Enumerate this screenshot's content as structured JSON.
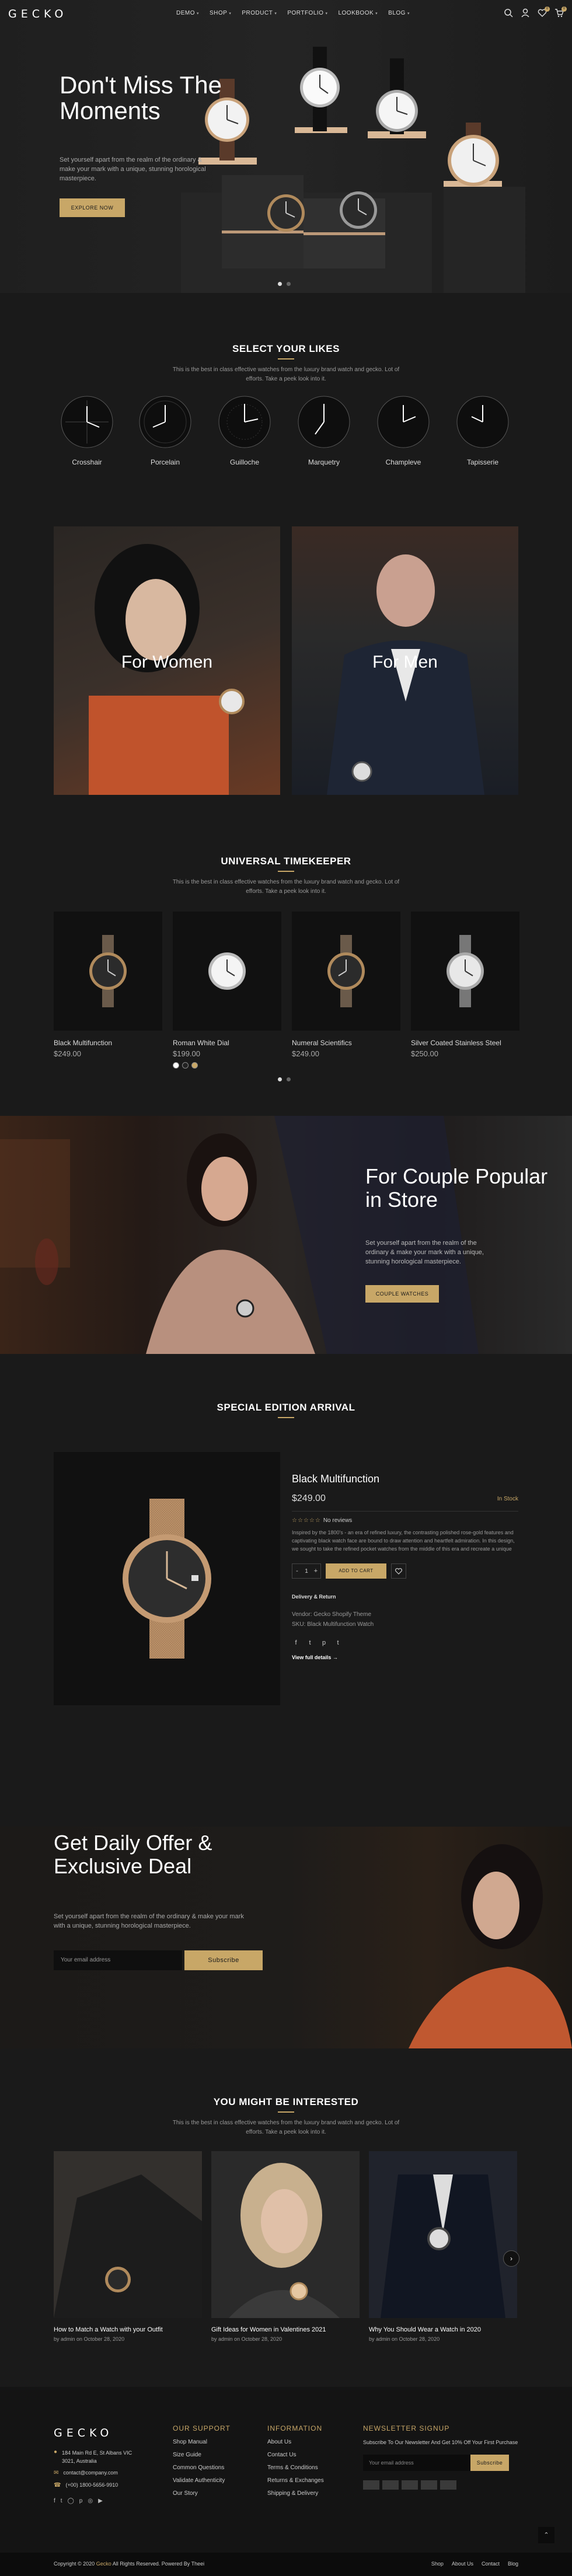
{
  "header": {
    "logo": "GECKO",
    "nav": [
      {
        "label": "DEMO"
      },
      {
        "label": "SHOP"
      },
      {
        "label": "PRODUCT"
      },
      {
        "label": "PORTFOLIO"
      },
      {
        "label": "LOOKBOOK"
      },
      {
        "label": "BLOG"
      }
    ],
    "wishlist_count": "0",
    "cart_count": "0"
  },
  "hero": {
    "title": "Don't Miss The Moments",
    "text": "Set yourself apart from the realm of the ordinary & make your mark with a unique, stunning horological masterpiece.",
    "button": "EXPLORE NOW"
  },
  "likes": {
    "title": "SELECT YOUR LIKES",
    "subtitle": "This is the best in class effective watches from the luxury brand watch and gecko. Lot of efforts. Take a peek look into it.",
    "categories": [
      {
        "label": "Crosshair"
      },
      {
        "label": "Porcelain"
      },
      {
        "label": "Guilloche"
      },
      {
        "label": "Marquetry"
      },
      {
        "label": "Champleve"
      },
      {
        "label": "Tapisserie"
      }
    ]
  },
  "banners": {
    "women": "For Women",
    "men": "For Men"
  },
  "timekeeper": {
    "title": "UNIVERSAL TIMEKEEPER",
    "subtitle": "This is the best in class effective watches from the luxury brand watch and gecko. Lot of efforts. Take a peek look into it.",
    "products": [
      {
        "name": "Black Multifunction",
        "price": "$249.00"
      },
      {
        "name": "Roman White Dial",
        "price": "$199.00"
      },
      {
        "name": "Numeral Scientifics",
        "price": "$249.00"
      },
      {
        "name": "Silver Coated Stainless Steel",
        "price": "$250.00"
      }
    ],
    "swatch_colors": [
      "#ffffff",
      "#222222",
      "#c8a767"
    ]
  },
  "couple": {
    "title": "For Couple Popular in Store",
    "text": "Set yourself apart from the realm of the ordinary & make your mark with a unique, stunning horological masterpiece.",
    "button": "COUPLE WATCHES"
  },
  "special": {
    "title": "SPECIAL EDITION ARRIVAL",
    "product": {
      "name": "Black Multifunction",
      "price": "$249.00",
      "stock": "In Stock",
      "reviews": "No reviews",
      "description": "Inspired by the 1800's - an era of refined luxury, the contrasting polished rose-gold features and captivating black watch face are bound to draw attention and heartfelt admiration. In this design, we sought to take the refined pocket watches from the middle of this era and recreate a unique",
      "qty": "1",
      "add_to_cart": "ADD TO CART",
      "delivery": "Delivery & Return",
      "vendor": "Vendor: Gecko Shopify Theme",
      "sku": "SKU: Black Multifunction Watch",
      "view_full": "View full details →"
    }
  },
  "offer": {
    "title": "Get Daily Offer & Exclusive Deal",
    "text": "Set yourself apart from the realm of the ordinary & make your mark with a unique, stunning horological masterpiece.",
    "email_placeholder": "Your email address",
    "button": "Subscribe"
  },
  "interested": {
    "title": "YOU MIGHT BE INTERESTED",
    "subtitle": "This is the best in class effective watches from the luxury brand watch and gecko. Lot of efforts. Take a peek look into it.",
    "posts": [
      {
        "title": "How to Match a Watch with your Outfit",
        "meta": "by admin on October 28, 2020"
      },
      {
        "title": "Gift Ideas for Women in Valentines 2021",
        "meta": "by admin on October 28, 2020"
      },
      {
        "title": "Why You Should Wear a Watch in 2020",
        "meta": "by admin on October 28, 2020"
      }
    ]
  },
  "footer": {
    "logo": "GECKO",
    "address": "184 Main Rd E, St Albans VIC 3021, Australia",
    "email": "contact@company.com",
    "phone": "(+00) 1800-5656-9910",
    "support": {
      "title": "OUR SUPPORT",
      "links": [
        "Shop Manual",
        "Size Guide",
        "Common Questions",
        "Validate Authenticity",
        "Our Story"
      ]
    },
    "information": {
      "title": "INFORMATION",
      "links": [
        "About Us",
        "Contact Us",
        "Terms & Conditions",
        "Returns & Exchanges",
        "Shipping & Delivery"
      ]
    },
    "newsletter": {
      "title": "NEWSLETTER SIGNUP",
      "text": "Subscribe To Our Newsletter And Get 10% Off Your First Purchase",
      "placeholder": "Your email address",
      "button": "Subscribe"
    },
    "copyright_pre": "Copyright © 2020",
    "copyright_brand": "Gecko",
    "copyright_post": "All Rights Reserved. Powered By Theei",
    "bottom_links": [
      "Shop",
      "About Us",
      "Contact",
      "Blog"
    ]
  },
  "colors": {
    "accent": "#c8a767",
    "background": "#1a1a1a"
  }
}
